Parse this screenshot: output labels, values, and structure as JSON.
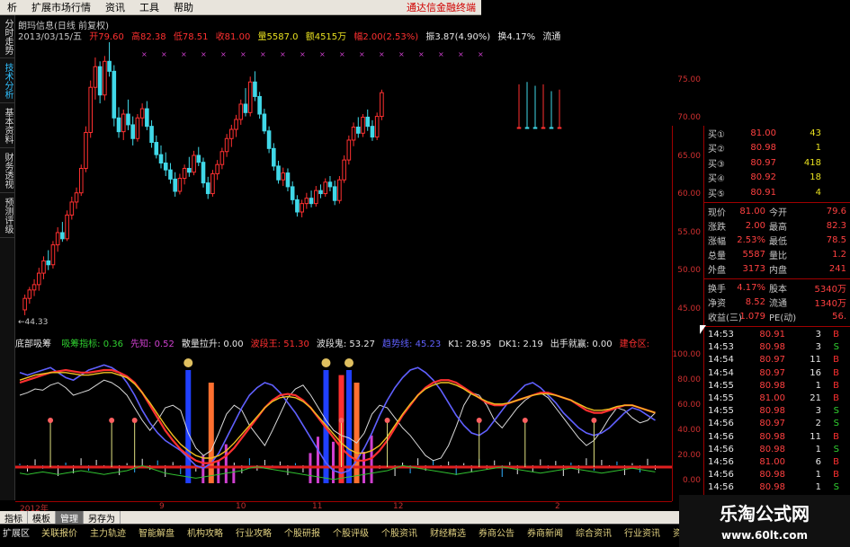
{
  "menu": {
    "items": [
      "析",
      "扩展市场行情",
      "资讯",
      "工具",
      "帮助"
    ],
    "brand": "通达信金融终端"
  },
  "left_tabs": [
    {
      "label": "分时走势",
      "active": false
    },
    {
      "label": "技术分析",
      "active": true
    },
    {
      "label": "基本资料",
      "active": false
    },
    {
      "label": "财务透视",
      "active": false
    },
    {
      "label": "预测评级",
      "active": false
    }
  ],
  "chart_header": {
    "title": "朗玛信息(日线 前复权)",
    "date": "2013/03/15/五",
    "open": "开79.60",
    "high": "高82.38",
    "low": "低78.51",
    "close": "收81.00",
    "volume": "量5587.0",
    "amount": "额4515万",
    "change": "幅2.00(2.53%)",
    "amplitude": "振3.87(4.90%)",
    "turnover": "换4.17%",
    "float": "流通"
  },
  "main_chart": {
    "low_label": "←44.33",
    "price_axis": [
      "75.00",
      "70.00",
      "65.00",
      "60.00",
      "55.00",
      "50.00",
      "45.00"
    ],
    "candles": [
      {
        "o": 45,
        "h": 47,
        "l": 44.3,
        "c": 46.5
      },
      {
        "o": 46.5,
        "h": 48,
        "l": 45.8,
        "c": 47.6
      },
      {
        "o": 47.6,
        "h": 49,
        "l": 46.8,
        "c": 48.3
      },
      {
        "o": 48.3,
        "h": 50.5,
        "l": 47.5,
        "c": 49.8
      },
      {
        "o": 49.8,
        "h": 52,
        "l": 49,
        "c": 51.4
      },
      {
        "o": 51.4,
        "h": 52.8,
        "l": 50.2,
        "c": 50.9
      },
      {
        "o": 50.9,
        "h": 54,
        "l": 50.4,
        "c": 53.5
      },
      {
        "o": 53.5,
        "h": 55.8,
        "l": 52.6,
        "c": 55.1
      },
      {
        "o": 55.1,
        "h": 56.5,
        "l": 53.9,
        "c": 54.3
      },
      {
        "o": 54.3,
        "h": 58,
        "l": 54,
        "c": 57.4
      },
      {
        "o": 57.4,
        "h": 59.8,
        "l": 56.8,
        "c": 59.1
      },
      {
        "o": 59.1,
        "h": 61,
        "l": 58.2,
        "c": 60.3
      },
      {
        "o": 60.3,
        "h": 64,
        "l": 59.9,
        "c": 63.5
      },
      {
        "o": 63.5,
        "h": 69,
        "l": 63,
        "c": 68.2
      },
      {
        "o": 68.2,
        "h": 75,
        "l": 67.5,
        "c": 74.1
      },
      {
        "o": 74.1,
        "h": 78,
        "l": 72.5,
        "c": 76.8
      },
      {
        "o": 76.8,
        "h": 77.5,
        "l": 72,
        "c": 73.1
      },
      {
        "o": 73.1,
        "h": 78.2,
        "l": 72.4,
        "c": 77.5
      },
      {
        "o": 77.5,
        "h": 80,
        "l": 75.5,
        "c": 76.2
      },
      {
        "o": 76.2,
        "h": 77,
        "l": 69,
        "c": 70.1
      },
      {
        "o": 70.1,
        "h": 71.5,
        "l": 67.5,
        "c": 68.3
      },
      {
        "o": 68.3,
        "h": 71.2,
        "l": 67.2,
        "c": 70.6
      },
      {
        "o": 70.6,
        "h": 72.5,
        "l": 68.5,
        "c": 69.2
      },
      {
        "o": 69.2,
        "h": 70.3,
        "l": 66.5,
        "c": 67.4
      },
      {
        "o": 67.4,
        "h": 70.6,
        "l": 67,
        "c": 70.1
      },
      {
        "o": 70.1,
        "h": 72,
        "l": 69,
        "c": 71.3
      },
      {
        "o": 71.3,
        "h": 72.3,
        "l": 68.5,
        "c": 69
      },
      {
        "o": 69,
        "h": 69.8,
        "l": 66.2,
        "c": 66.9
      },
      {
        "o": 66.9,
        "h": 67.8,
        "l": 64.8,
        "c": 65.3
      },
      {
        "o": 65.3,
        "h": 66.5,
        "l": 63.5,
        "c": 64.2
      },
      {
        "o": 64.2,
        "h": 65.6,
        "l": 62.5,
        "c": 63.3
      },
      {
        "o": 63.3,
        "h": 64.2,
        "l": 61.5,
        "c": 62.1
      },
      {
        "o": 62.1,
        "h": 63,
        "l": 59.8,
        "c": 60.5
      },
      {
        "o": 60.5,
        "h": 62.8,
        "l": 60.1,
        "c": 62.2
      },
      {
        "o": 62.2,
        "h": 64,
        "l": 61.4,
        "c": 63.5
      },
      {
        "o": 63.5,
        "h": 65,
        "l": 62.4,
        "c": 63
      },
      {
        "o": 63,
        "h": 65.8,
        "l": 62.6,
        "c": 65.2
      },
      {
        "o": 65.2,
        "h": 66.3,
        "l": 63.8,
        "c": 64.3
      },
      {
        "o": 64.3,
        "h": 64.9,
        "l": 61,
        "c": 61.6
      },
      {
        "o": 61.6,
        "h": 62.4,
        "l": 59.5,
        "c": 60.2
      },
      {
        "o": 60.2,
        "h": 63.3,
        "l": 59.8,
        "c": 62.8
      },
      {
        "o": 62.8,
        "h": 64.6,
        "l": 62,
        "c": 64
      },
      {
        "o": 64,
        "h": 66.2,
        "l": 63.4,
        "c": 65.7
      },
      {
        "o": 65.7,
        "h": 68,
        "l": 65,
        "c": 67.4
      },
      {
        "o": 67.4,
        "h": 69.2,
        "l": 66.3,
        "c": 68.6
      },
      {
        "o": 68.6,
        "h": 70.5,
        "l": 67.6,
        "c": 69.9
      },
      {
        "o": 69.9,
        "h": 72.5,
        "l": 69.2,
        "c": 71.9
      },
      {
        "o": 71.9,
        "h": 74,
        "l": 70.3,
        "c": 70.8
      },
      {
        "o": 70.8,
        "h": 75.5,
        "l": 70.3,
        "c": 74.8
      },
      {
        "o": 74.8,
        "h": 76.2,
        "l": 72.3,
        "c": 72.9
      },
      {
        "o": 72.9,
        "h": 73.5,
        "l": 70,
        "c": 70.6
      },
      {
        "o": 70.6,
        "h": 71.3,
        "l": 68,
        "c": 68.4
      },
      {
        "o": 68.4,
        "h": 69,
        "l": 65.5,
        "c": 66.1
      },
      {
        "o": 66.1,
        "h": 66.8,
        "l": 63.2,
        "c": 63.8
      },
      {
        "o": 63.8,
        "h": 64.5,
        "l": 61.5,
        "c": 62
      },
      {
        "o": 62,
        "h": 63.6,
        "l": 61.2,
        "c": 62.9
      },
      {
        "o": 62.9,
        "h": 63.5,
        "l": 60.5,
        "c": 61.1
      },
      {
        "o": 61.1,
        "h": 61.8,
        "l": 58.8,
        "c": 59.4
      },
      {
        "o": 59.4,
        "h": 60,
        "l": 57.2,
        "c": 57.8
      },
      {
        "o": 57.8,
        "h": 59.4,
        "l": 57.1,
        "c": 58.9
      },
      {
        "o": 58.9,
        "h": 60.3,
        "l": 58.2,
        "c": 59.6
      },
      {
        "o": 59.6,
        "h": 60.6,
        "l": 58.4,
        "c": 58.9
      },
      {
        "o": 58.9,
        "h": 61.2,
        "l": 58.5,
        "c": 60.6
      },
      {
        "o": 60.6,
        "h": 61.4,
        "l": 59.6,
        "c": 60.2
      },
      {
        "o": 60.2,
        "h": 62.2,
        "l": 59.8,
        "c": 61.7
      },
      {
        "o": 61.7,
        "h": 62.5,
        "l": 60.5,
        "c": 61.1
      },
      {
        "o": 61.1,
        "h": 61.9,
        "l": 58.7,
        "c": 59.3
      },
      {
        "o": 59.3,
        "h": 62.5,
        "l": 58.9,
        "c": 62
      },
      {
        "o": 62,
        "h": 65.2,
        "l": 61.6,
        "c": 64.6
      },
      {
        "o": 64.6,
        "h": 67.8,
        "l": 64,
        "c": 67.2
      },
      {
        "o": 67.2,
        "h": 69.5,
        "l": 66.4,
        "c": 68.9
      },
      {
        "o": 68.9,
        "h": 70.2,
        "l": 67.5,
        "c": 68.1
      },
      {
        "o": 68.1,
        "h": 70.6,
        "l": 67.6,
        "c": 70.2
      },
      {
        "o": 70.2,
        "h": 71.2,
        "l": 68.4,
        "c": 69
      },
      {
        "o": 69,
        "h": 69.8,
        "l": 67.1,
        "c": 67.6
      },
      {
        "o": 67.6,
        "h": 70.8,
        "l": 67.2,
        "c": 70.3
      },
      {
        "o": 70.3,
        "h": 73.8,
        "l": 69.8,
        "c": 73.4
      }
    ],
    "right_candles": [
      {
        "o": 75,
        "h": 77,
        "l": 74.5,
        "c": 76.5
      },
      {
        "o": 77,
        "h": 78,
        "l": 74.8,
        "c": 75.4
      },
      {
        "o": 75.4,
        "h": 76.6,
        "l": 74.3,
        "c": 74.9
      },
      {
        "o": 74.9,
        "h": 77,
        "l": 74.5,
        "c": 76.6
      },
      {
        "o": 76.6,
        "h": 77,
        "l": 73.6,
        "c": 74.1
      },
      {
        "o": 74.1,
        "h": 77,
        "l": 73.8,
        "c": 76.7
      }
    ]
  },
  "indicator_header": {
    "name": "底部吸筹",
    "items": [
      {
        "label": "吸筹指标: 0.36",
        "color": "#30d030"
      },
      {
        "label": "先知: 0.52",
        "color": "#d040d0"
      },
      {
        "label": "散量拉升: 0.00",
        "color": "#e8e8e8"
      },
      {
        "label": "波段王: 51.30",
        "color": "#ff3030"
      },
      {
        "label": "波段鬼: 53.27",
        "color": "#e8e8e8"
      },
      {
        "label": "趋势线: 45.23",
        "color": "#6060ff"
      },
      {
        "label": "K1: 28.95",
        "color": "#e8e8e8"
      },
      {
        "label": "DK1: 2.19",
        "color": "#e8e8e8"
      },
      {
        "label": "出手就赢: 0.00",
        "color": "#e8e8e8"
      },
      {
        "label": "建仓区:",
        "color": "#ff3030"
      }
    ],
    "axis": [
      "100.00",
      "80.00",
      "60.00",
      "40.00",
      "20.00",
      "0.00"
    ]
  },
  "indicator_data": {
    "threshold": 20,
    "white": [
      70,
      72,
      75,
      74,
      78,
      80,
      76,
      70,
      72,
      74,
      78,
      82,
      80,
      76,
      70,
      60,
      50,
      42,
      50,
      60,
      62,
      58,
      40,
      28,
      22,
      26,
      40,
      55,
      62,
      58,
      46,
      38,
      30,
      42,
      55,
      68,
      75,
      78,
      70,
      60,
      50,
      42,
      38,
      36,
      32,
      40,
      55,
      62,
      60,
      52,
      44,
      38,
      30,
      22,
      18,
      20,
      30,
      45,
      62,
      72,
      70,
      62,
      50,
      44,
      52,
      60,
      66,
      70,
      72,
      68,
      60,
      52,
      44,
      36,
      30,
      34,
      42,
      52,
      60,
      58,
      52,
      48,
      50,
      56
    ],
    "blue": [
      88,
      86,
      88,
      90,
      92,
      88,
      84,
      82,
      86,
      90,
      92,
      94,
      92,
      88,
      80,
      70,
      58,
      48,
      40,
      34,
      30,
      26,
      20,
      14,
      12,
      16,
      24,
      36,
      48,
      60,
      70,
      76,
      80,
      78,
      72,
      64,
      56,
      46,
      36,
      26,
      16,
      10,
      8,
      10,
      18,
      28,
      40,
      54,
      66,
      76,
      84,
      90,
      92,
      88,
      82,
      74,
      64,
      54,
      46,
      40,
      38,
      42,
      50,
      58,
      66,
      72,
      78,
      80,
      76,
      70,
      64,
      56,
      50,
      44,
      40,
      38,
      40,
      44,
      50,
      56,
      60,
      58,
      54,
      50
    ],
    "orange": [
      80,
      82,
      84,
      86,
      88,
      89,
      90,
      89,
      88,
      88,
      89,
      90,
      90,
      88,
      85,
      80,
      72,
      62,
      52,
      42,
      34,
      27,
      22,
      18,
      16,
      16,
      18,
      22,
      28,
      36,
      44,
      52,
      60,
      66,
      70,
      71,
      70,
      66,
      60,
      52,
      44,
      36,
      28,
      22,
      18,
      18,
      20,
      26,
      34,
      44,
      54,
      62,
      70,
      76,
      80,
      82,
      82,
      80,
      76,
      72,
      68,
      64,
      62,
      62,
      64,
      66,
      68,
      70,
      72,
      72,
      70,
      68,
      66,
      62,
      58,
      56,
      56,
      58,
      60,
      62,
      62,
      60,
      58,
      56
    ],
    "yellow": [
      82,
      84,
      86,
      87,
      88,
      88,
      88,
      87,
      86,
      86,
      87,
      88,
      88,
      86,
      84,
      79,
      72,
      64,
      55,
      46,
      38,
      31,
      26,
      22,
      20,
      20,
      22,
      26,
      32,
      39,
      46,
      53,
      60,
      65,
      68,
      69,
      68,
      65,
      60,
      53,
      46,
      39,
      32,
      27,
      24,
      24,
      26,
      30,
      37,
      46,
      55,
      63,
      70,
      75,
      78,
      80,
      80,
      78,
      75,
      71,
      68,
      65,
      63,
      63,
      64,
      66,
      68,
      70,
      71,
      71,
      70,
      68,
      66,
      63,
      60,
      58,
      58,
      59,
      61,
      62,
      62,
      60,
      58,
      56
    ],
    "green": [
      8,
      7,
      8,
      9,
      8,
      7,
      8,
      9,
      10,
      9,
      8,
      7,
      8,
      9,
      10,
      12,
      14,
      12,
      10,
      8,
      7,
      6,
      5,
      4,
      5,
      6,
      7,
      8,
      9,
      10,
      12,
      13,
      12,
      11,
      10,
      9,
      8,
      7,
      6,
      5,
      4,
      3,
      4,
      5,
      6,
      7,
      8,
      9,
      10,
      12,
      14,
      13,
      12,
      11,
      10,
      9,
      8,
      7,
      8,
      9,
      10,
      11,
      12,
      13,
      12,
      11,
      10,
      9,
      8,
      9,
      10,
      11,
      12,
      11,
      10,
      9,
      8,
      9,
      10,
      11,
      12,
      11,
      10,
      9
    ],
    "tall_bars": [
      {
        "i": 22,
        "color": "#2040ff",
        "v": 90
      },
      {
        "i": 25,
        "color": "#ff7030",
        "v": 80
      },
      {
        "i": 40,
        "color": "#2040ff",
        "v": 90
      },
      {
        "i": 42,
        "color": "#ff3030",
        "v": 86
      },
      {
        "i": 43,
        "color": "#2040ff",
        "v": 90
      },
      {
        "i": 44,
        "color": "#ff7030",
        "v": 80
      }
    ],
    "markers": [
      4,
      12,
      15,
      42,
      48,
      60,
      66,
      75
    ],
    "coin_markers": [
      22,
      40,
      43
    ]
  },
  "quote": {
    "buys": [
      {
        "label": "买①",
        "price": "81.00",
        "vol": "43"
      },
      {
        "label": "买②",
        "price": "80.98",
        "vol": "1"
      },
      {
        "label": "买③",
        "price": "80.97",
        "vol": "418"
      },
      {
        "label": "买④",
        "price": "80.92",
        "vol": "18"
      },
      {
        "label": "买⑤",
        "price": "80.91",
        "vol": "4"
      }
    ],
    "stats": [
      {
        "a": "现价",
        "b": "81.00",
        "c": "今开",
        "d": "79.6"
      },
      {
        "a": "涨跌",
        "b": "2.00",
        "c": "最高",
        "d": "82.3"
      },
      {
        "a": "涨幅",
        "b": "2.53%",
        "c": "最低",
        "d": "78.5"
      },
      {
        "a": "总量",
        "b": "5587",
        "c": "量比",
        "d": "1.2"
      },
      {
        "a": "外盘",
        "b": "3173",
        "c": "内盘",
        "d": "241"
      }
    ],
    "stats2": [
      {
        "a": "换手",
        "b": "4.17%",
        "c": "股本",
        "d": "5340万"
      },
      {
        "a": "净资",
        "b": "8.52",
        "c": "流通",
        "d": "1340万"
      },
      {
        "a": "收益(三)",
        "b": "1.079",
        "c": "PE(动)",
        "d": "56."
      }
    ],
    "ticks": [
      {
        "t": "14:53",
        "p": "80.91",
        "v": "3",
        "s": "B",
        "col": "#ff3030"
      },
      {
        "t": "14:53",
        "p": "80.98",
        "v": "3",
        "s": "S",
        "col": "#30d030"
      },
      {
        "t": "14:54",
        "p": "80.97",
        "v": "11",
        "s": "B",
        "col": "#ff3030"
      },
      {
        "t": "14:54",
        "p": "80.97",
        "v": "16",
        "s": "B",
        "col": "#ff3030"
      },
      {
        "t": "14:55",
        "p": "80.98",
        "v": "1",
        "s": "B",
        "col": "#ff3030"
      },
      {
        "t": "14:55",
        "p": "81.00",
        "v": "21",
        "s": "B",
        "col": "#ff3030"
      },
      {
        "t": "14:55",
        "p": "80.98",
        "v": "3",
        "s": "S",
        "col": "#30d030"
      },
      {
        "t": "14:56",
        "p": "80.97",
        "v": "2",
        "s": "S",
        "col": "#30d030"
      },
      {
        "t": "14:56",
        "p": "80.98",
        "v": "11",
        "s": "B",
        "col": "#ff3030"
      },
      {
        "t": "14:56",
        "p": "80.98",
        "v": "1",
        "s": "S",
        "col": "#30d030"
      },
      {
        "t": "14:56",
        "p": "81.00",
        "v": "6",
        "s": "B",
        "col": "#ff3030"
      },
      {
        "t": "14:56",
        "p": "80.98",
        "v": "1",
        "s": "B",
        "col": "#ff3030"
      },
      {
        "t": "14:56",
        "p": "80.98",
        "v": "1",
        "s": "S",
        "col": "#30d030"
      },
      {
        "t": "14:56",
        "p": "80.98",
        "v": "1",
        "s": "B",
        "col": "#ff3030"
      }
    ]
  },
  "date_strip": [
    "2012年",
    "9",
    "10",
    "11",
    "12",
    "2"
  ],
  "tabs": [
    {
      "label": "指标",
      "selected": false
    },
    {
      "label": "模板",
      "selected": false
    },
    {
      "label": "管理",
      "selected": true
    },
    {
      "label": "另存为",
      "selected": false
    }
  ],
  "nav": [
    "扩展区",
    "关联报价",
    "主力轨迹",
    "智能解盘",
    "机构攻略",
    "行业攻略",
    "个股研报",
    "个股评级",
    "个股资讯",
    "财经精选",
    "券商公告",
    "券商新闻",
    "综合资讯",
    "行业资讯",
    "资讯"
  ],
  "watermark": {
    "line1": "乐淘公式网",
    "line2": "www.60lt.com"
  },
  "colors": {
    "up": "#ff3030",
    "down": "#40d8e8",
    "axis": "#a00000"
  }
}
